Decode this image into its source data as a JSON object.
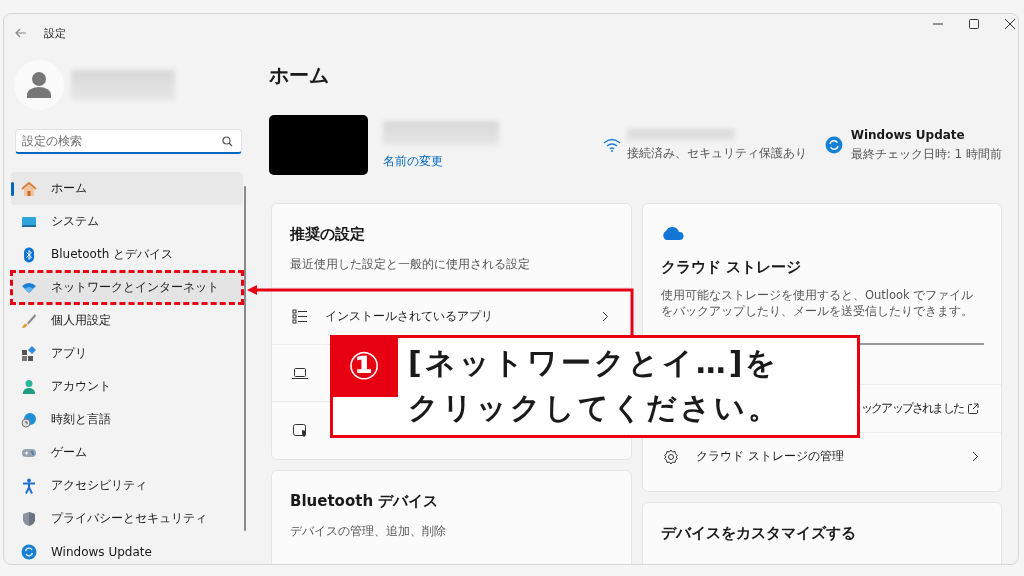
{
  "window": {
    "title": "設定"
  },
  "search": {
    "placeholder": "設定の検索"
  },
  "sidebar": {
    "items": [
      {
        "label": "ホーム",
        "selected": true,
        "hovered": false
      },
      {
        "label": "システム",
        "selected": false,
        "hovered": false
      },
      {
        "label": "Bluetooth とデバイス",
        "selected": false,
        "hovered": false
      },
      {
        "label": "ネットワークとインターネット",
        "selected": false,
        "hovered": true
      },
      {
        "label": "個人用設定",
        "selected": false,
        "hovered": false
      },
      {
        "label": "アプリ",
        "selected": false,
        "hovered": false
      },
      {
        "label": "アカウント",
        "selected": false,
        "hovered": false
      },
      {
        "label": "時刻と言語",
        "selected": false,
        "hovered": false
      },
      {
        "label": "ゲーム",
        "selected": false,
        "hovered": false
      },
      {
        "label": "アクセシビリティ",
        "selected": false,
        "hovered": false
      },
      {
        "label": "プライバシーとセキュリティ",
        "selected": false,
        "hovered": false
      },
      {
        "label": "Windows Update",
        "selected": false,
        "hovered": false
      }
    ]
  },
  "page": {
    "title": "ホーム",
    "rename_link": "名前の変更",
    "network_status": "接続済み、セキュリティ保護あり",
    "update": {
      "title": "Windows Update",
      "status": "最終チェック日時: 1 時間前"
    }
  },
  "recommended": {
    "title": "推奨の設定",
    "subtitle": "最近使用した設定と一般的に使用される設定",
    "rows": [
      {
        "label": "インストールされているアプリ"
      },
      {},
      {}
    ]
  },
  "bluetooth_card": {
    "title": "Bluetooth デバイス",
    "subtitle": "デバイスの管理、追加、削除"
  },
  "cloud_card": {
    "title": "クラウド ストレージ",
    "description": "使用可能なストレージを使用すると、Outlook でファイルをバックアップしたり、メールを送受信したりできます。",
    "backup_status": "ックアップされました",
    "manage": "クラウド ストレージの管理"
  },
  "customize_card": {
    "title": "デバイスをカスタマイズする"
  },
  "annotation": {
    "number": "①",
    "lines": [
      "[ネットワークとイ…]を",
      "クリックしてください。"
    ]
  }
}
